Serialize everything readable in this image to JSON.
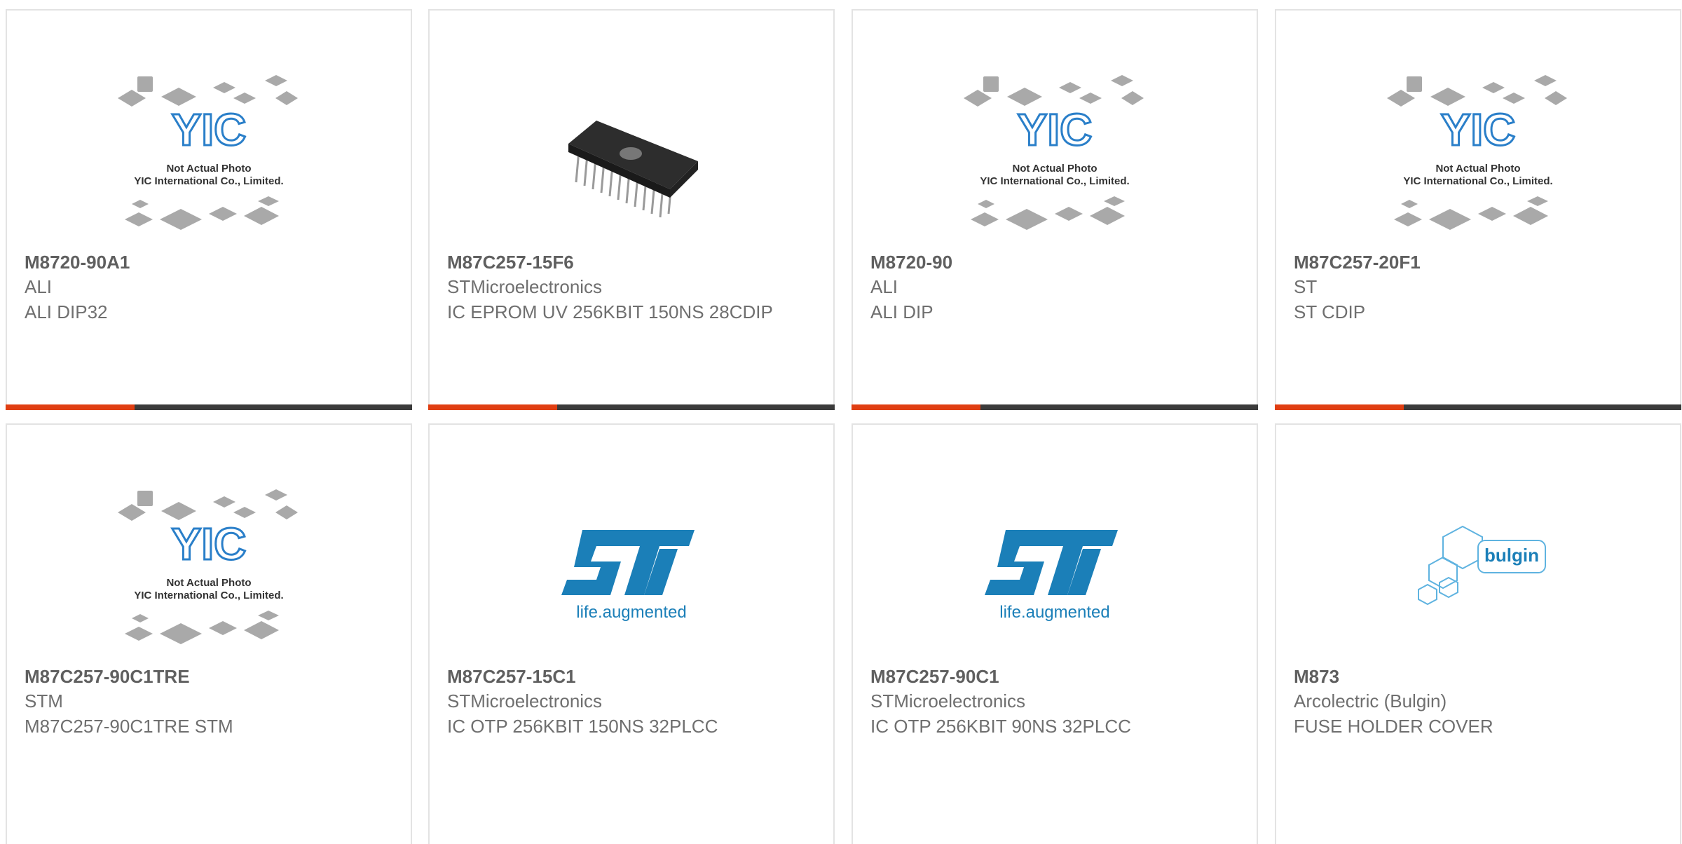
{
  "products": [
    {
      "part": "M8720-90A1",
      "manufacturer": "ALI",
      "description": "ALI DIP32",
      "image": "placeholder-photo-icon",
      "placeholder_text": [
        "Not Actual Photo",
        "YIC International Co., Limited."
      ]
    },
    {
      "part": "M87C257-15F6",
      "manufacturer": "STMicroelectronics",
      "description": "IC EPROM UV 256KBIT 150NS 28CDIP",
      "image": "dip-chip-photo"
    },
    {
      "part": "M8720-90",
      "manufacturer": "ALI",
      "description": "ALI DIP",
      "image": "placeholder-photo-icon",
      "placeholder_text": [
        "Not Actual Photo",
        "YIC International Co., Limited."
      ]
    },
    {
      "part": "M87C257-20F1",
      "manufacturer": "ST",
      "description": "ST CDIP",
      "image": "placeholder-photo-icon",
      "placeholder_text": [
        "Not Actual Photo",
        "YIC International Co., Limited."
      ]
    },
    {
      "part": "M87C257-90C1TRE",
      "manufacturer": "STM",
      "description": "M87C257-90C1TRE STM",
      "image": "placeholder-photo-icon",
      "placeholder_text": [
        "Not Actual Photo",
        "YIC International Co., Limited."
      ]
    },
    {
      "part": "M87C257-15C1",
      "manufacturer": "STMicroelectronics",
      "description": "IC OTP 256KBIT 150NS 32PLCC",
      "image": "st-logo",
      "logo_text": "life.augmented"
    },
    {
      "part": "M87C257-90C1",
      "manufacturer": "STMicroelectronics",
      "description": "IC OTP 256KBIT 90NS 32PLCC",
      "image": "st-logo",
      "logo_text": "life.augmented"
    },
    {
      "part": "M873",
      "manufacturer": "Arcolectric (Bulgin)",
      "description": "FUSE HOLDER COVER",
      "image": "bulgin-logo",
      "logo_text": "bulgin"
    }
  ],
  "colors": {
    "accent": "#e03e12",
    "bar": "#3b3b3b",
    "yic_blue": "#2a7fc9",
    "st_blue": "#1b7fb8"
  }
}
